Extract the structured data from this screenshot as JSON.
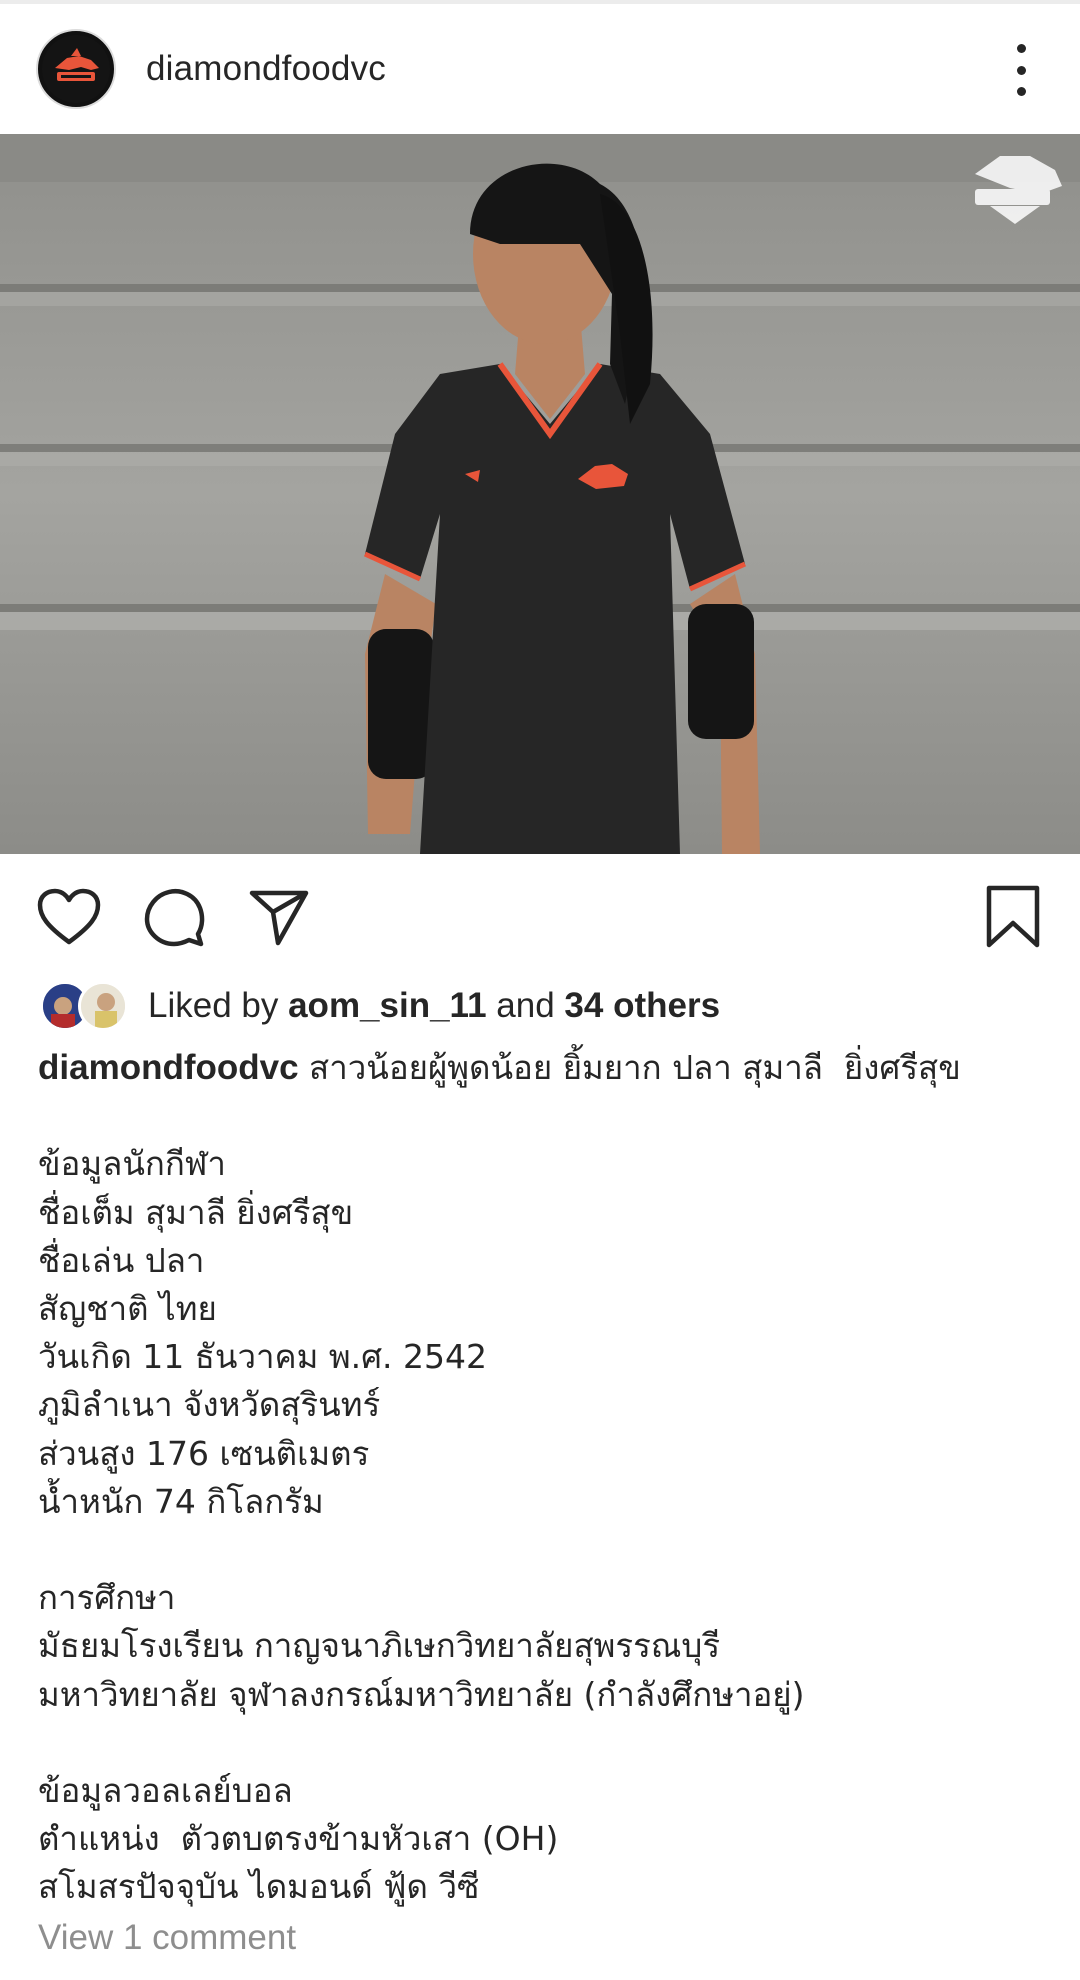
{
  "colors": {
    "text": "#262626",
    "muted": "#8e8e8e",
    "brand_orange": "#e8553a"
  },
  "post": {
    "username": "diamondfoodvc",
    "avatar_icon": "diamond-food-logo-icon",
    "more_icon": "more-vertical-icon",
    "photo_watermark": "DIAMOND FOOD"
  },
  "actions": {
    "like_icon": "heart-icon",
    "comment_icon": "comment-bubble-icon",
    "share_icon": "send-icon",
    "save_icon": "bookmark-icon"
  },
  "likes": {
    "prefix": "Liked by ",
    "user": "aom_sin_11",
    "middle": " and ",
    "others": "34 others"
  },
  "caption": {
    "username": "diamondfoodvc",
    "first_line": " สาวน้อยผู้พูดน้อย ยิ้มยาก ปลา สุมาลี  ยิ่งศรีสุข",
    "section1": [
      "ข้อมูลนักกีฬา",
      "ชื่อเต็ม สุมาลี ยิ่งศรีสุข",
      "ชื่อเล่น ปลา",
      "สัญชาติ ไทย",
      "วันเกิด 11 ธันวาคม พ.ศ. 2542",
      "ภูมิลำเนา จังหวัดสุรินทร์",
      "ส่วนสูง 176 เซนติเมตร",
      "น้ำหนัก 74 กิโลกรัม"
    ],
    "section2": [
      "การศึกษา",
      "มัธยมโรงเรียน กาญจนาภิเษกวิทยาลัยสุพรรณบุรี",
      "มหาวิทยาลัย จุฬาลงกรณ์มหาวิทยาลัย (กำลังศึกษาอยู่)"
    ],
    "section3": [
      "ข้อมูลวอลเลย์บอล",
      "ตำแหน่ง  ตัวตบตรงข้ามหัวเสา (OH)",
      "สโมสรปัจจุบัน ไดมอนด์ ฟู้ด วีซี"
    ]
  },
  "view_comments": "View 1 comment"
}
